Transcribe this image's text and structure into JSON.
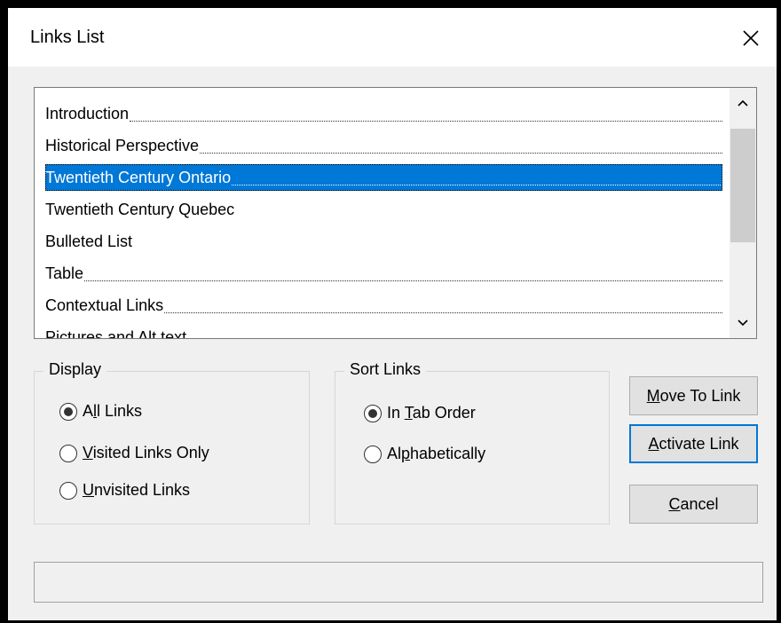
{
  "window": {
    "title": "Links List",
    "close_glyph": "✕"
  },
  "links_list": {
    "items": [
      {
        "label": "Introduction",
        "dotted": true,
        "selected": false
      },
      {
        "label": "Historical Perspective",
        "dotted": true,
        "selected": false
      },
      {
        "label": "Twentieth Century Ontario",
        "dotted": true,
        "selected": true
      },
      {
        "label": "Twentieth Century Quebec",
        "dotted": false,
        "selected": false
      },
      {
        "label": "Bulleted List",
        "dotted": false,
        "selected": false
      },
      {
        "label": "Table",
        "dotted": true,
        "selected": false
      },
      {
        "label": "Contextual Links",
        "dotted": true,
        "selected": false
      },
      {
        "label": "Pictures and Alt text",
        "dotted": false,
        "selected": false
      }
    ]
  },
  "display": {
    "label": "Display",
    "options": [
      {
        "pre": "A",
        "u": "l",
        "post": "l Links",
        "checked": true
      },
      {
        "pre": "",
        "u": "V",
        "post": "isited Links Only",
        "checked": false
      },
      {
        "pre": "",
        "u": "U",
        "post": "nvisited Links",
        "checked": false
      }
    ]
  },
  "sort_links": {
    "label": "Sort Links",
    "options": [
      {
        "pre": "In ",
        "u": "T",
        "post": "ab Order",
        "checked": true
      },
      {
        "pre": "Al",
        "u": "p",
        "post": "habetically",
        "checked": false
      }
    ]
  },
  "buttons": {
    "move_to_link": {
      "u": "M",
      "post": "ove To Link"
    },
    "activate_link": {
      "u": "A",
      "post": "ctivate Link"
    },
    "cancel": {
      "u": "C",
      "post": "ancel"
    }
  },
  "colors": {
    "selection": "#0078d7",
    "default_button_border": "#0078d7"
  },
  "icons": {
    "close": "close-icon",
    "scroll_up": "chevron-up-icon",
    "scroll_down": "chevron-down-icon"
  }
}
